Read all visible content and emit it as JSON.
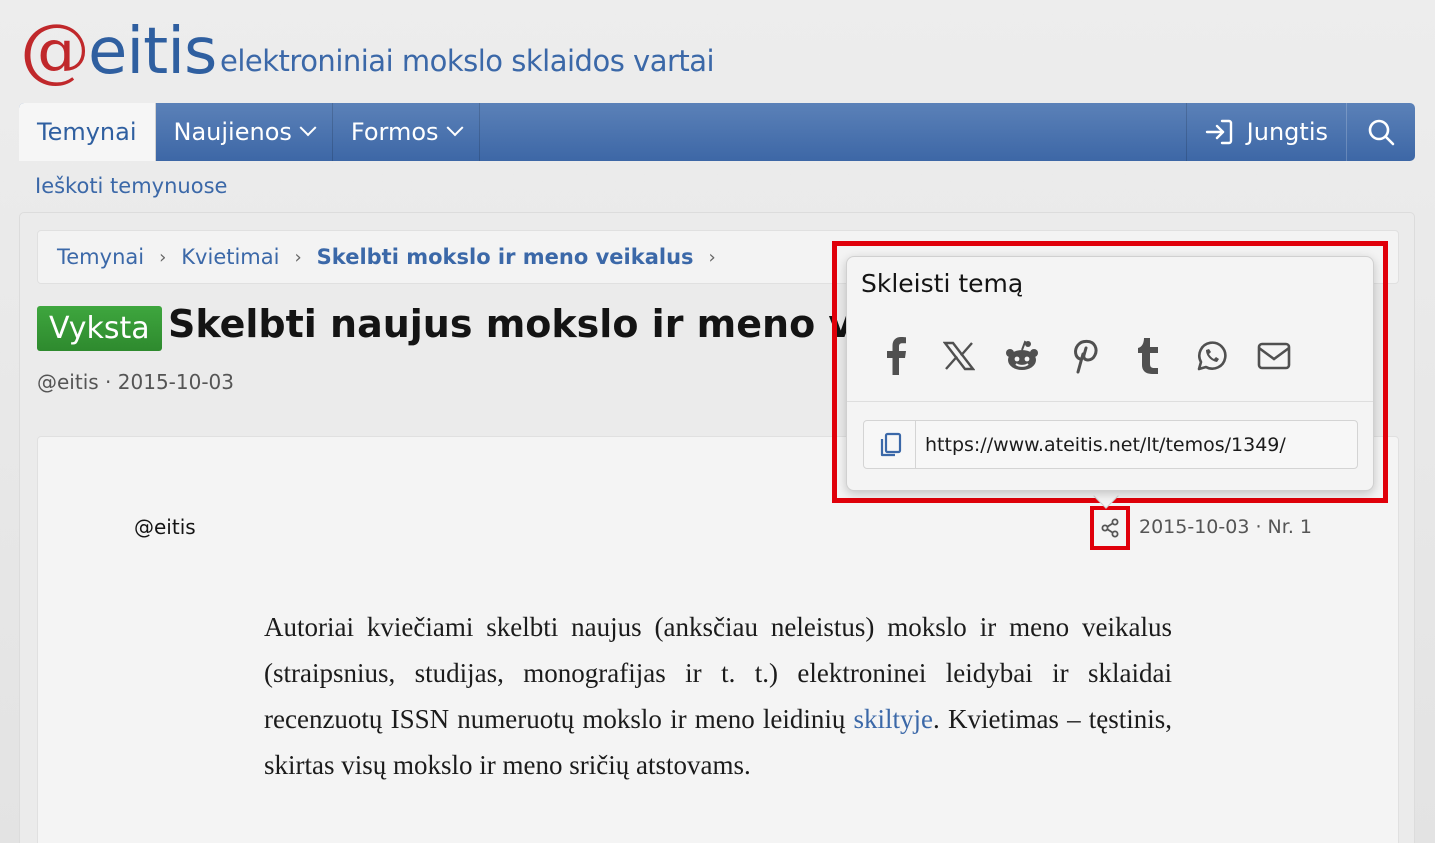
{
  "header": {
    "logo_at": "@",
    "logo_word": "eitis",
    "tagline": "elektroniniai mokslo sklaidos vartai"
  },
  "nav": {
    "tabs": [
      {
        "label": "Temynai",
        "active": true
      },
      {
        "label": "Naujienos",
        "dropdown": true
      },
      {
        "label": "Formos",
        "dropdown": true
      }
    ],
    "login_label": "Jungtis",
    "search_icon": "search-icon"
  },
  "search_link": "Ieškoti temynuose",
  "breadcrumbs": [
    "Temynai",
    "Kvietimai",
    "Skelbti mokslo ir meno veikalus"
  ],
  "thread": {
    "status": "Vyksta",
    "title": "Skelbti naujus mokslo ir meno veika",
    "author": "@eitis",
    "date": "2015-10-03"
  },
  "post": {
    "author": "@eitis",
    "date": "2015-10-03",
    "number": "Nr. 1",
    "body_before_link": "Autoriai kviečiami skelbti naujus (anksčiau neleistus) mokslo ir meno veikalus (straipsnius, studijas, monografijas ir t. t.) elektroninei leidybai ir sklaidai recenzuotų ISSN numeruotų mokslo ir meno leidinių ",
    "body_link": "skiltyje",
    "body_after_link": ". Kvietimas – tęstinis, skirtas visų mokslo ir meno sričių atstovams."
  },
  "share_popup": {
    "title": "Skleisti temą",
    "networks": [
      "facebook",
      "x",
      "reddit",
      "pinterest",
      "tumblr",
      "whatsapp",
      "email"
    ],
    "url": "https://www.ateitis.net/lt/temos/1349/"
  },
  "colors": {
    "brand_blue": "#3d67a6",
    "logo_red": "#c0282b",
    "status_green": "#2e8a2e",
    "highlight_red": "#e0000a"
  }
}
